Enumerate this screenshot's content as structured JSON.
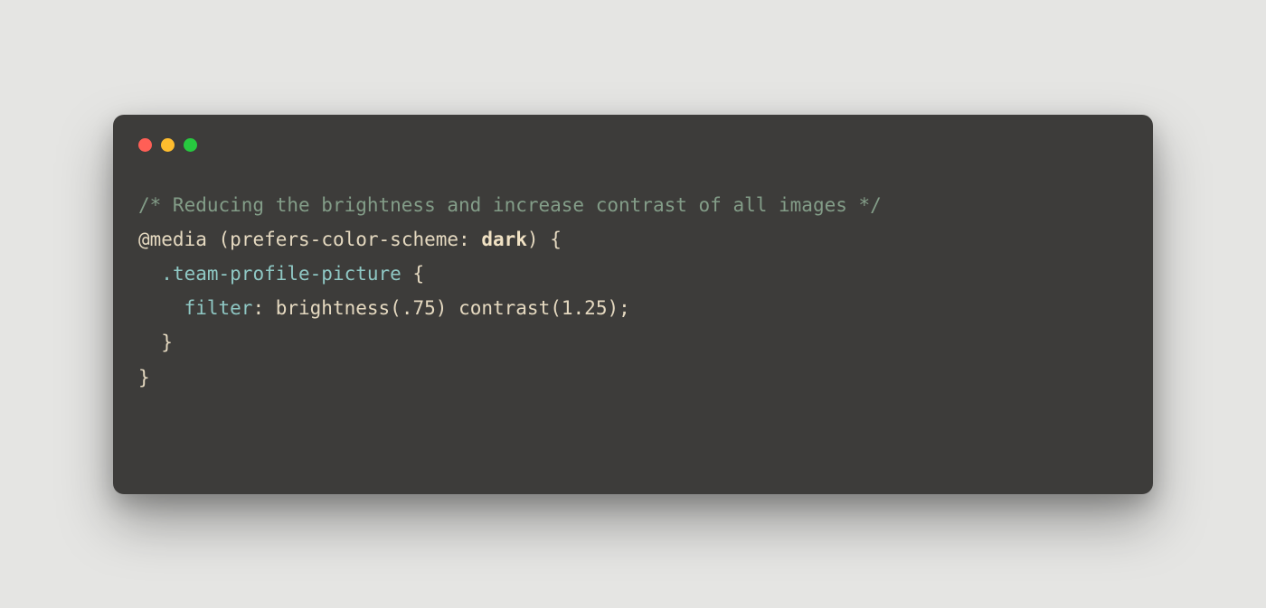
{
  "window": {
    "traffic_lights": {
      "red": "#ff5f56",
      "yellow": "#ffbd2e",
      "green": "#27c93f"
    }
  },
  "code": {
    "language": "css",
    "comment": "/* Reducing the brightness and increase contrast of all images */",
    "at_rule": "@media",
    "paren_open": "(",
    "media_feature": "prefers-color-scheme",
    "feature_colon": ": ",
    "media_value": "dark",
    "paren_close": ")",
    "brace_open_1": " {",
    "indent_1": "  ",
    "selector": ".team-profile-picture",
    "brace_open_2": " {",
    "indent_2": "    ",
    "property": "filter",
    "prop_colon": ": ",
    "func1_name": "brightness",
    "func1_open": "(",
    "func1_arg": ".75",
    "func1_close": ")",
    "func_sep": " ",
    "func2_name": "contrast",
    "func2_open": "(",
    "func2_arg": "1.25",
    "func2_close": ")",
    "semicolon": ";",
    "brace_close_2_indent": "  ",
    "brace_close_2": "}",
    "brace_close_1": "}"
  }
}
